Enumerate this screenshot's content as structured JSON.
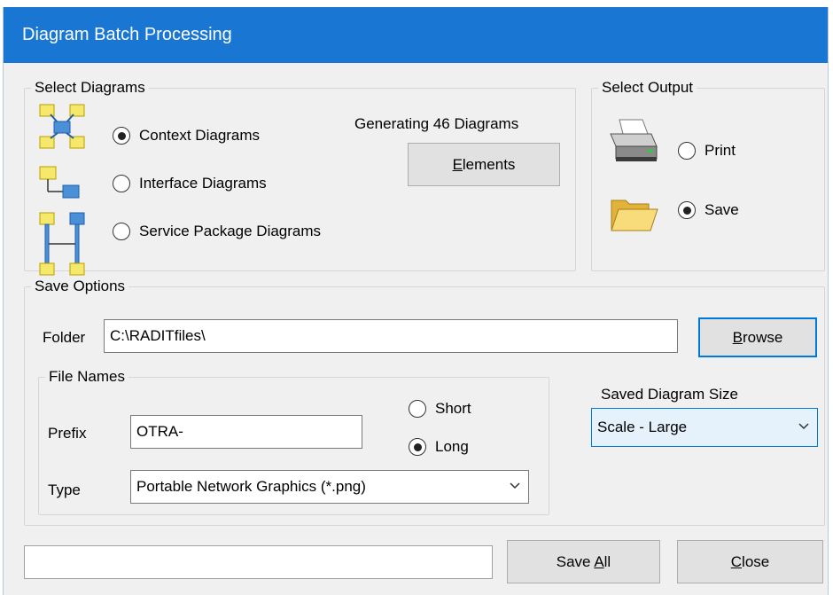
{
  "window": {
    "title": "Diagram Batch Processing"
  },
  "select_diagrams": {
    "label": "Select Diagrams",
    "options": [
      {
        "label": "Context Diagrams",
        "selected": true
      },
      {
        "label": "Interface Diagrams",
        "selected": false
      },
      {
        "label": "Service Package Diagrams",
        "selected": false
      }
    ],
    "status": "Generating 46 Diagrams",
    "elements_button": {
      "prefix": "",
      "mnemonic": "E",
      "rest": "lements"
    }
  },
  "select_output": {
    "label": "Select Output",
    "options": [
      {
        "label": "Print",
        "selected": false,
        "icon": "printer-icon"
      },
      {
        "label": "Save",
        "selected": true,
        "icon": "folder-icon"
      }
    ]
  },
  "save_options": {
    "label": "Save Options",
    "folder_label": "Folder",
    "folder_value": "C:\\RADITfiles\\",
    "browse_button": {
      "prefix": "",
      "mnemonic": "B",
      "rest": "rowse"
    },
    "file_names": {
      "label": "File Names",
      "prefix_label": "Prefix",
      "prefix_value": "OTRA-",
      "name_options": [
        {
          "label": "Short",
          "selected": false
        },
        {
          "label": "Long",
          "selected": true
        }
      ],
      "type_label": "Type",
      "type_value": "Portable Network Graphics (*.png)"
    },
    "size_label": "Saved Diagram Size",
    "size_value": "Scale - Large"
  },
  "footer": {
    "status_value": "",
    "save_all_button": {
      "prefix": "Save ",
      "mnemonic": "A",
      "rest": "ll"
    },
    "close_button": {
      "prefix": "",
      "mnemonic": "C",
      "rest": "lose"
    }
  },
  "colors": {
    "titlebar": "#1976d2",
    "focus": "#0078d7",
    "dialog_bg": "#f0f0f0"
  }
}
